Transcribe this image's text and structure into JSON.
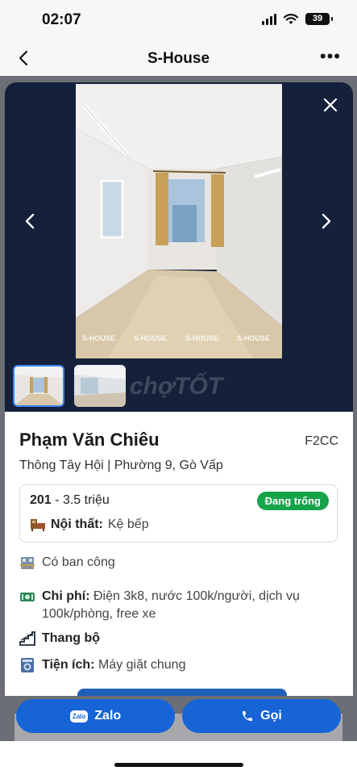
{
  "status_bar": {
    "time": "02:07",
    "battery": "39"
  },
  "nav": {
    "title": "S-House"
  },
  "gallery": {
    "watermark_text": "S-HOUSE",
    "site_watermark": "chợTỐT",
    "thumbnail_count": 2,
    "selected_index": 0
  },
  "listing": {
    "title": "Phạm Văn Chiêu",
    "code": "F2CC",
    "address": "Thông Tây Hội | Phường 9, Gò Vấp",
    "room": {
      "number": "201",
      "price": "3.5 triệu",
      "status": "Đang trống",
      "furniture_label": "Nội thất:",
      "furniture_value": "Kệ bếp"
    },
    "balcony": "Có ban công",
    "cost_label": "Chi phí:",
    "cost_value": "Điện 3k8, nước 100k/người, dịch vụ 100k/phòng, free xe",
    "stairs": "Thang bộ",
    "amenity_label": "Tiện ích:",
    "amenity_value": "Máy giặt chung"
  },
  "actions": {
    "zalo_label": "Zalo",
    "zalo_icon_text": "Zalo",
    "call_label": "Gọi"
  },
  "colors": {
    "primary": "#1764d6",
    "status_green": "#16a34a",
    "gallery_bg": "#15213a"
  }
}
